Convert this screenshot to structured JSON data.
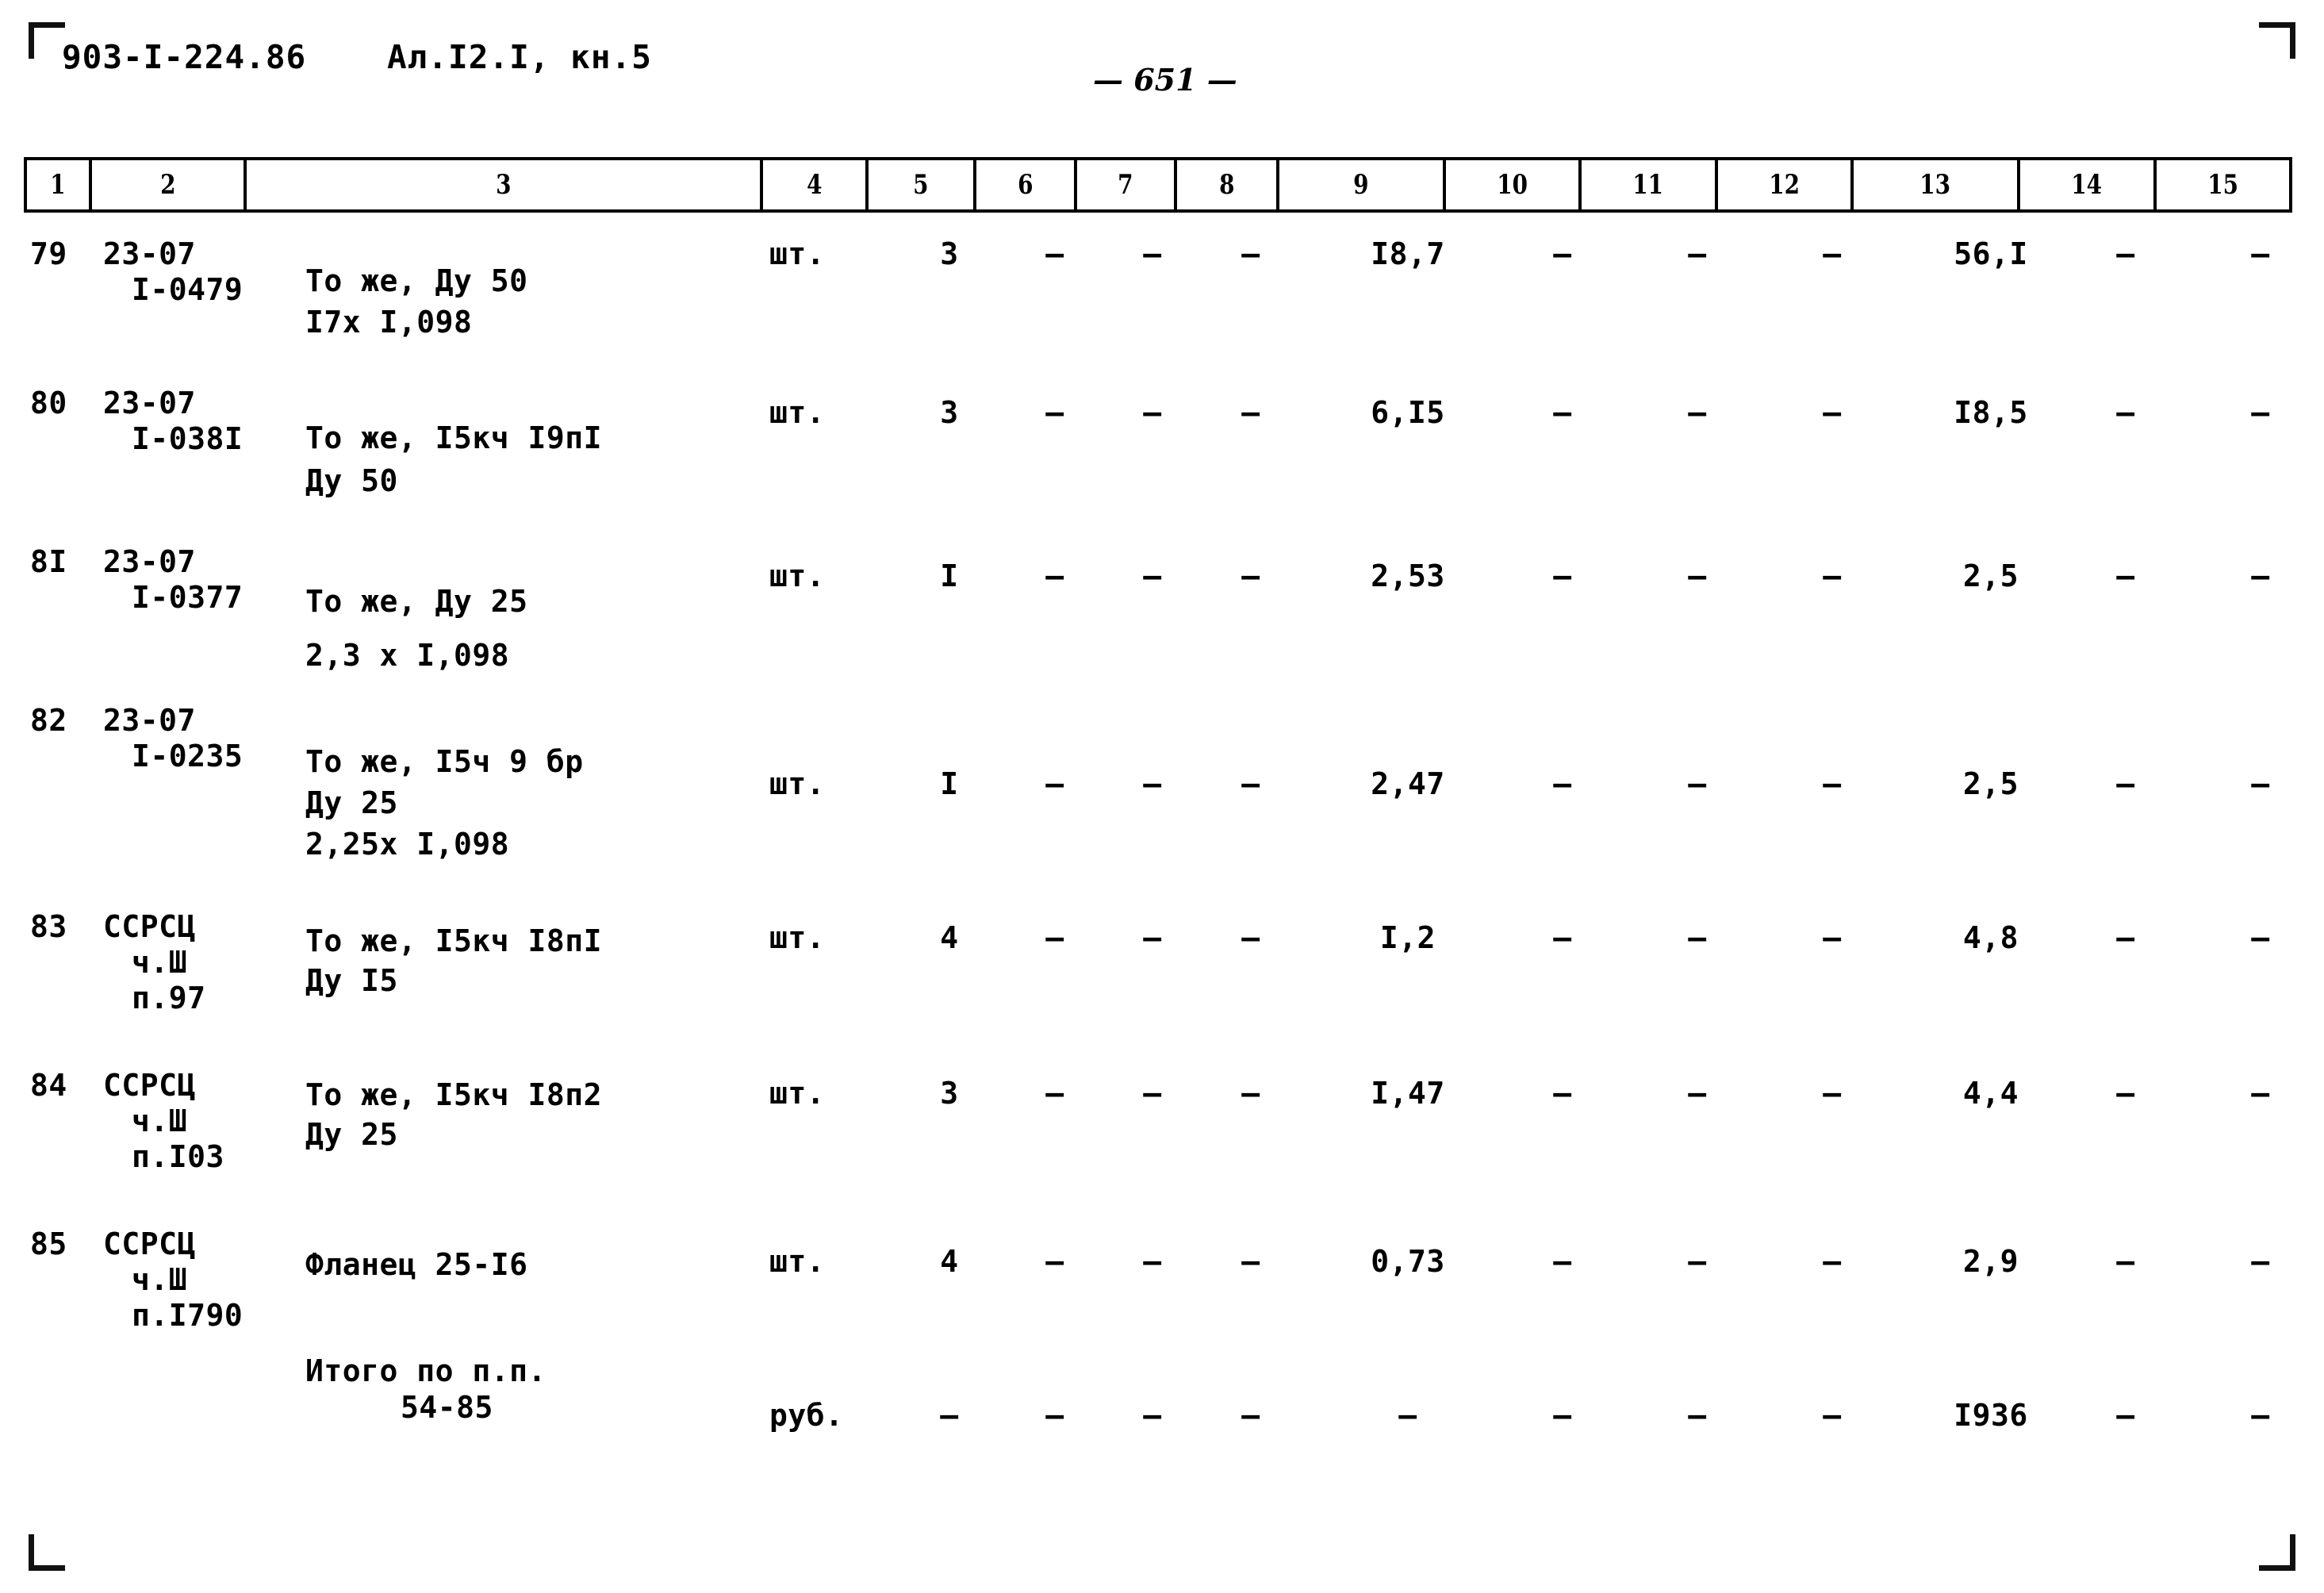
{
  "header": {
    "doc_code": "903-I-224.86",
    "album": "Ал.I2.I, кн.5",
    "page_number": "— 651 —"
  },
  "table": {
    "column_headers": [
      "1",
      "2",
      "3",
      "4",
      "5",
      "6",
      "7",
      "8",
      "9",
      "10",
      "11",
      "12",
      "13",
      "14",
      "15"
    ],
    "rows": [
      {
        "no": "79",
        "code_line1": "23-07",
        "code_line2": "I-0479",
        "desc_line1": "То же, Ду 50",
        "desc_line2": "I7х I,098",
        "desc_line3": "",
        "unit": "шт.",
        "c5": "3",
        "c6": "–",
        "c7": "–",
        "c8": "–",
        "c9": "I8,7",
        "c10": "–",
        "c11": "–",
        "c12": "–",
        "c13": "56,I",
        "c14": "–",
        "c15": "–"
      },
      {
        "no": "80",
        "code_line1": "23-07",
        "code_line2": "I-038I",
        "desc_line1": "То же, I5кч I9пI",
        "desc_line2": "Ду 50",
        "desc_line3": "",
        "unit": "шт.",
        "c5": "3",
        "c6": "–",
        "c7": "–",
        "c8": "–",
        "c9": "6,I5",
        "c10": "–",
        "c11": "–",
        "c12": "–",
        "c13": "I8,5",
        "c14": "–",
        "c15": "–"
      },
      {
        "no": "8I",
        "code_line1": "23-07",
        "code_line2": "I-0377",
        "desc_line1": "То же, Ду 25",
        "desc_line2": "2,3 х I,098",
        "desc_line3": "",
        "unit": "шт.",
        "c5": "I",
        "c6": "–",
        "c7": "–",
        "c8": "–",
        "c9": "2,53",
        "c10": "–",
        "c11": "–",
        "c12": "–",
        "c13": "2,5",
        "c14": "–",
        "c15": "–"
      },
      {
        "no": "82",
        "code_line1": "23-07",
        "code_line2": "I-0235",
        "desc_line1": "То же, I5ч 9 бр",
        "desc_line2": "Ду 25",
        "desc_line3": "2,25х I,098",
        "unit": "шт.",
        "c5": "I",
        "c6": "–",
        "c7": "–",
        "c8": "–",
        "c9": "2,47",
        "c10": "–",
        "c11": "–",
        "c12": "–",
        "c13": "2,5",
        "c14": "–",
        "c15": "–"
      },
      {
        "no": "83",
        "code_line1": "ССРСЦ",
        "code_line2": "ч.Ш",
        "code_line3": "п.97",
        "desc_line1": "То же, I5кч I8пI",
        "desc_line2": "Ду I5",
        "desc_line3": "",
        "unit": "шт.",
        "c5": "4",
        "c6": "–",
        "c7": "–",
        "c8": "–",
        "c9": "I,2",
        "c10": "–",
        "c11": "–",
        "c12": "–",
        "c13": "4,8",
        "c14": "–",
        "c15": "–"
      },
      {
        "no": "84",
        "code_line1": "ССРСЦ",
        "code_line2": "ч.Ш",
        "code_line3": "п.I03",
        "desc_line1": "То же, I5кч I8п2",
        "desc_line2": "Ду 25",
        "desc_line3": "",
        "unit": "шт.",
        "c5": "3",
        "c6": "–",
        "c7": "–",
        "c8": "–",
        "c9": "I,47",
        "c10": "–",
        "c11": "–",
        "c12": "–",
        "c13": "4,4",
        "c14": "–",
        "c15": "–"
      },
      {
        "no": "85",
        "code_line1": "ССРСЦ",
        "code_line2": "ч.Ш",
        "code_line3": "п.I790",
        "desc_line1": "Фланец 25-I6",
        "desc_line2": "",
        "desc_line3": "",
        "unit": "шт.",
        "c5": "4",
        "c6": "–",
        "c7": "–",
        "c8": "–",
        "c9": "0,73",
        "c10": "–",
        "c11": "–",
        "c12": "–",
        "c13": "2,9",
        "c14": "–",
        "c15": "–"
      }
    ],
    "total_row": {
      "no": "",
      "code_line1": "",
      "code_line2": "",
      "desc_line1": "Итого по п.п.",
      "desc_line2": "54-85",
      "desc_line3": "",
      "unit": "руб.",
      "c5": "–",
      "c6": "–",
      "c7": "–",
      "c8": "–",
      "c9": "–",
      "c10": "–",
      "c11": "–",
      "c12": "–",
      "c13": "I936",
      "c14": "–",
      "c15": "–"
    }
  }
}
